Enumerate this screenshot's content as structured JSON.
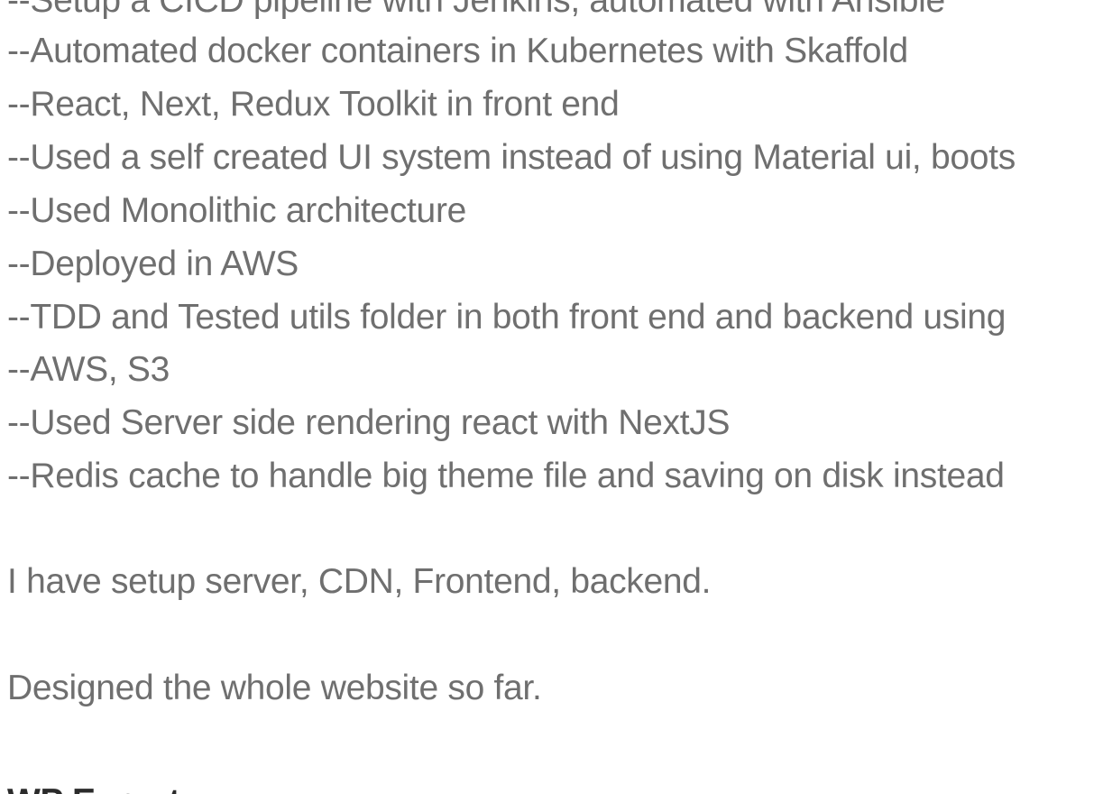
{
  "content": {
    "bullets": [
      "--Setup a CICD pipeline with Jenkins, automated with Ansible",
      "--Automated docker containers in Kubernetes with Skaffold",
      "--React, Next, Redux Toolkit in front end",
      "--Used a self created UI system instead of using Material ui, boots",
      "--Used Monolithic architecture",
      "--Deployed in AWS",
      "--TDD and Tested utils folder in both front end and backend using",
      "--AWS, S3",
      "--Used Server side rendering react with NextJS",
      "--Redis cache to handle big theme file and saving on disk instead"
    ],
    "paragraph_1": "I have setup server, CDN, Frontend, backend.",
    "paragraph_2": "Designed the whole website so far.",
    "next_heading": "WP Expert"
  }
}
